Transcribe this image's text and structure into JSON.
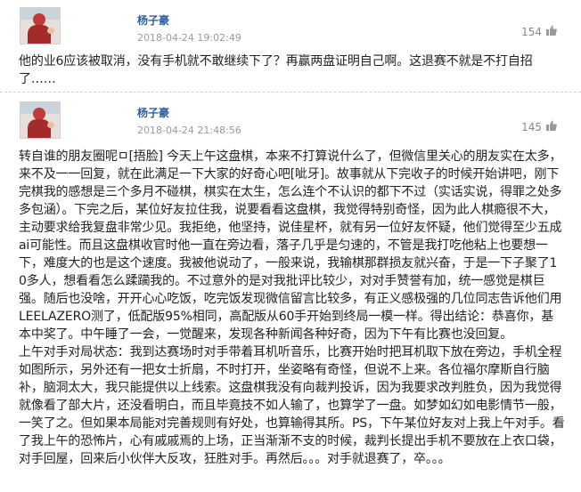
{
  "comments": [
    {
      "username": "杨子豪",
      "timestamp": "2018-04-24 19:02:49",
      "likes": "154",
      "paragraphs": [
        "他的业6应该被取消，没有手机就不敢继续下了？再赢两盘证明自己啊。这退赛不就是不打自招了……"
      ]
    },
    {
      "username": "杨子豪",
      "timestamp": "2018-04-24 21:48:56",
      "likes": "145",
      "paragraphs": [
        "转自谁的朋友圈呢ㅁ[捂脸] 今天上午这盘棋，本来不打算说什么了，但微信里关心的朋友实在太多，来不及一一回复，就在此满足一下大家的好奇心吧[呲牙]。故事就从下完收子的时候开始讲吧，刚下完棋我的感想是三个多月不碰棋，棋实在太生，怎么连个不认识的都下不过（实话实说，得罪之处多多包涵）。下完之后，某位好友拉住我，说要看看这盘棋，我觉得特别奇怪，因为此人棋瘾很不大，主动要求给我复盘非常少见。我拒绝，他坚持，说佳星杯，就有另一位好友怀疑，他们觉得至少五成ai可能性。而且这盘棋收官时他一直在旁边看，落子几乎是匀速的，不管是我打吃他粘上也要想一下，难度大的也是这个速度。我被他说动了，一般来说，我输棋那群损友就兴奋，于是一下子聚了10多人，想看看怎么蹂躏我的。不过意外的是对我批评比较少，对对手赞誉有加，统一感觉是棋巨强。随后也没啥，开开心心吃饭，吃完饭发现微信留言比较多，有正义感极强的几位同志告诉他们用LEELAZERO测了，低配版95%相同，高配版从60手开始到终局一模一样。得出结论：恭喜你，基本中奖了。中午睡了一会，一觉醒来，发现各种新闻各种好奇，因为下午有比赛也没回复。",
        "上午对手对局状态：我到达赛场时对手带着耳机听音乐，比赛开始时把耳机取下放在旁边，手机全程如图所示，另外还有一把女士折扇，不时打开，坐姿略有奇怪，但说不上来。各位福尔摩斯自行脑补，脑洞太大，我只能提供以上线索。这盘棋我没有向裁判投诉，因为我要求改判胜负，因为我觉得就像看了部大片，还没看明白，而且毕竟技不如人输了，也算学了一盘。如梦如幻如电影情节一般，一笑了之。但如果本局能对完善规则有好处，也算输得其所。PS，下午某位好友对上我上午对手。看了我上午的恐怖片，心有戚戚焉的上场，正当渐渐不支的时候，裁判长提出手机不要放在上衣口袋，对手回屋，回来后小伙伴大反攻，狂胜对手。再然后。。。对手就退赛了，卒。。。"
      ]
    }
  ]
}
